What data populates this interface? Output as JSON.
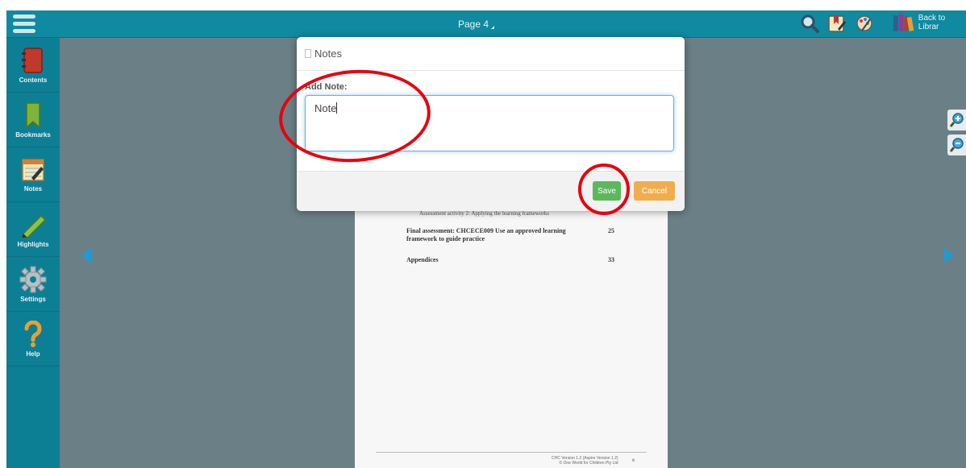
{
  "topbar": {
    "page_label": "Page 4",
    "back_to_library": "Back to Librar"
  },
  "sidebar": {
    "items": [
      {
        "label": "Contents",
        "icon": "notebook-icon"
      },
      {
        "label": "Bookmarks",
        "icon": "bookmark-icon"
      },
      {
        "label": "Notes",
        "icon": "notepad-pencil-icon"
      },
      {
        "label": "Highlights",
        "icon": "highlighter-icon"
      },
      {
        "label": "Settings",
        "icon": "gear-icon"
      },
      {
        "label": "Help",
        "icon": "question-mark-icon"
      }
    ]
  },
  "document": {
    "cut_row": "Assessment activity 2: Applying the learning frameworks",
    "rows": [
      {
        "title": "Final assessment: CHCECE009 Use an approved learning",
        "title2": "framework to guide practice",
        "page": "25"
      },
      {
        "title": "Appendices",
        "page": "33"
      }
    ],
    "footer_line1": "CHC Version 1.2 (Aspire Version 1.2)",
    "footer_line2": "© One World for Children Pty Ltd",
    "footer_page": "iii"
  },
  "modal": {
    "title": "Notes",
    "add_label": "Add Note:",
    "note_value": "Note",
    "save_label": "Save",
    "cancel_label": "Cancel"
  },
  "colors": {
    "topbar": "#0f8aa0",
    "sidebar": "#0d7f95",
    "reader_bg": "#6b7f86",
    "save": "#5cb85c",
    "cancel": "#f0ad4e",
    "annotation_circle": "#e8000f"
  }
}
